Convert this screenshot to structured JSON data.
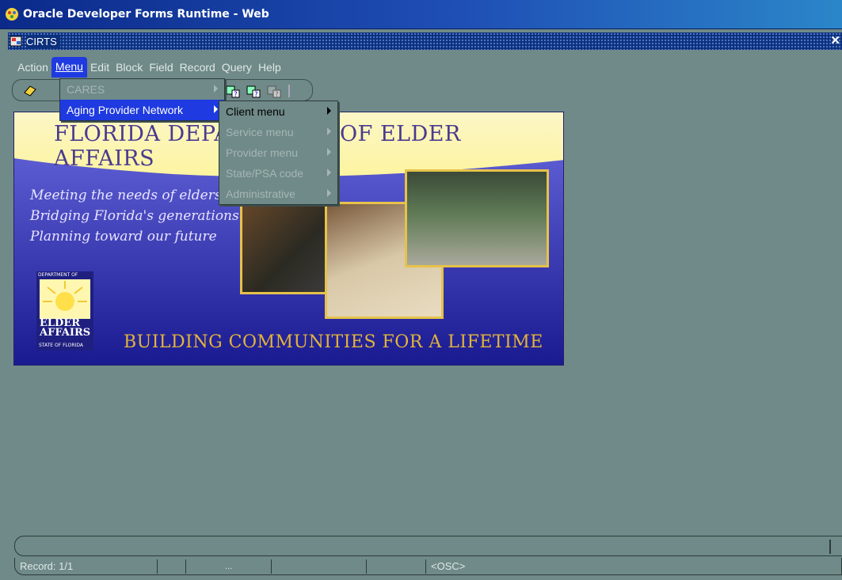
{
  "window": {
    "title": "Oracle Developer Forms Runtime - Web"
  },
  "form": {
    "title": "CIRTS"
  },
  "menubar": [
    {
      "label": "Action",
      "active": false
    },
    {
      "label": "Menu",
      "active": true
    },
    {
      "label": "Edit",
      "active": false
    },
    {
      "label": "Block",
      "active": false
    },
    {
      "label": "Field",
      "active": false
    },
    {
      "label": "Record",
      "active": false
    },
    {
      "label": "Query",
      "active": false
    },
    {
      "label": "Help",
      "active": false
    }
  ],
  "menu_dropdown": [
    {
      "label": "CARES",
      "disabled": true,
      "selected": false
    },
    {
      "label": "Aging Provider Network",
      "disabled": false,
      "selected": true
    }
  ],
  "submenu": [
    {
      "label": "Client menu",
      "disabled": false
    },
    {
      "label": "Service menu",
      "disabled": true
    },
    {
      "label": "Provider menu",
      "disabled": true
    },
    {
      "label": "State/PSA code",
      "disabled": true
    },
    {
      "label": "Administrative",
      "disabled": true
    }
  ],
  "toolbar_icons": [
    "save-icon",
    "query-icon",
    "query-execute-icon",
    "query-cancel-icon",
    "next-icon"
  ],
  "banner": {
    "headline": "FLORIDA DEPARTMENT OF ELDER AFFAIRS",
    "tagline_1": "Meeting the needs of elders",
    "tagline_2": "Bridging Florida's generations",
    "tagline_3": "Planning toward our future",
    "footer": "BUILDING COMMUNITIES FOR A LIFETIME",
    "logo_top": "DEPARTMENT OF",
    "logo_name": "ELDER AFFAIRS",
    "logo_sub": "STATE OF FLORIDA"
  },
  "status": {
    "record": "Record: 1/1",
    "ellipsis": "...",
    "osc": "<OSC>"
  },
  "colors": {
    "background": "#6f8a88",
    "menu_highlight": "#1e3ae0",
    "titlebar": "#0b2a8a"
  }
}
